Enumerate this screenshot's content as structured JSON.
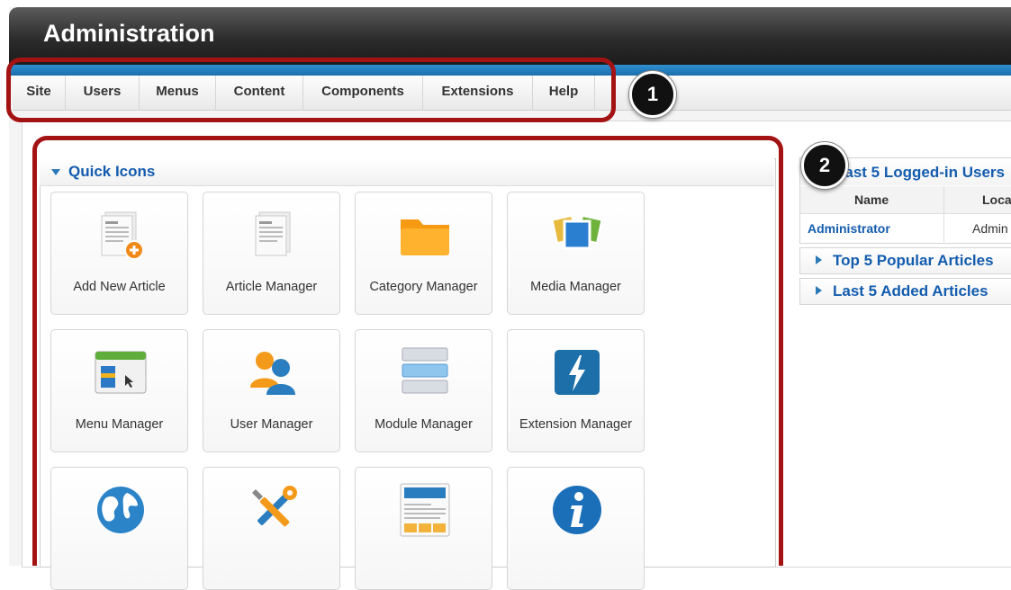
{
  "app": {
    "title": "Administration"
  },
  "menu": {
    "items": [
      {
        "label": "Site"
      },
      {
        "label": "Users"
      },
      {
        "label": "Menus"
      },
      {
        "label": "Content"
      },
      {
        "label": "Components"
      },
      {
        "label": "Extensions"
      },
      {
        "label": "Help"
      }
    ]
  },
  "quick_icons": {
    "title": "Quick Icons",
    "tiles": [
      {
        "label": "Add New Article",
        "icon": "add-article-icon"
      },
      {
        "label": "Article Manager",
        "icon": "article-icon"
      },
      {
        "label": "Category Manager",
        "icon": "folder-icon"
      },
      {
        "label": "Media Manager",
        "icon": "media-icon"
      },
      {
        "label": "Menu Manager",
        "icon": "menu-window-icon"
      },
      {
        "label": "User Manager",
        "icon": "users-icon"
      },
      {
        "label": "Module Manager",
        "icon": "module-stack-icon"
      },
      {
        "label": "Extension Manager",
        "icon": "lightning-icon"
      },
      {
        "label": "",
        "icon": "globe-icon"
      },
      {
        "label": "",
        "icon": "tools-icon"
      },
      {
        "label": "",
        "icon": "template-icon"
      },
      {
        "label": "",
        "icon": "info-icon"
      }
    ]
  },
  "right_panels": {
    "logged_in": {
      "title": "Last 5 Logged-in Users",
      "columns": [
        "Name",
        "Loca"
      ],
      "rows": [
        {
          "name": "Administrator",
          "location": "Admin"
        }
      ]
    },
    "popular": {
      "title": "Top 5 Popular Articles"
    },
    "added": {
      "title": "Last 5 Added Articles"
    }
  },
  "callouts": [
    "1",
    "2"
  ],
  "colors": {
    "accent_blue": "#135cae",
    "highlight_red": "#a41313",
    "menu_blue": "#1d6fad"
  }
}
